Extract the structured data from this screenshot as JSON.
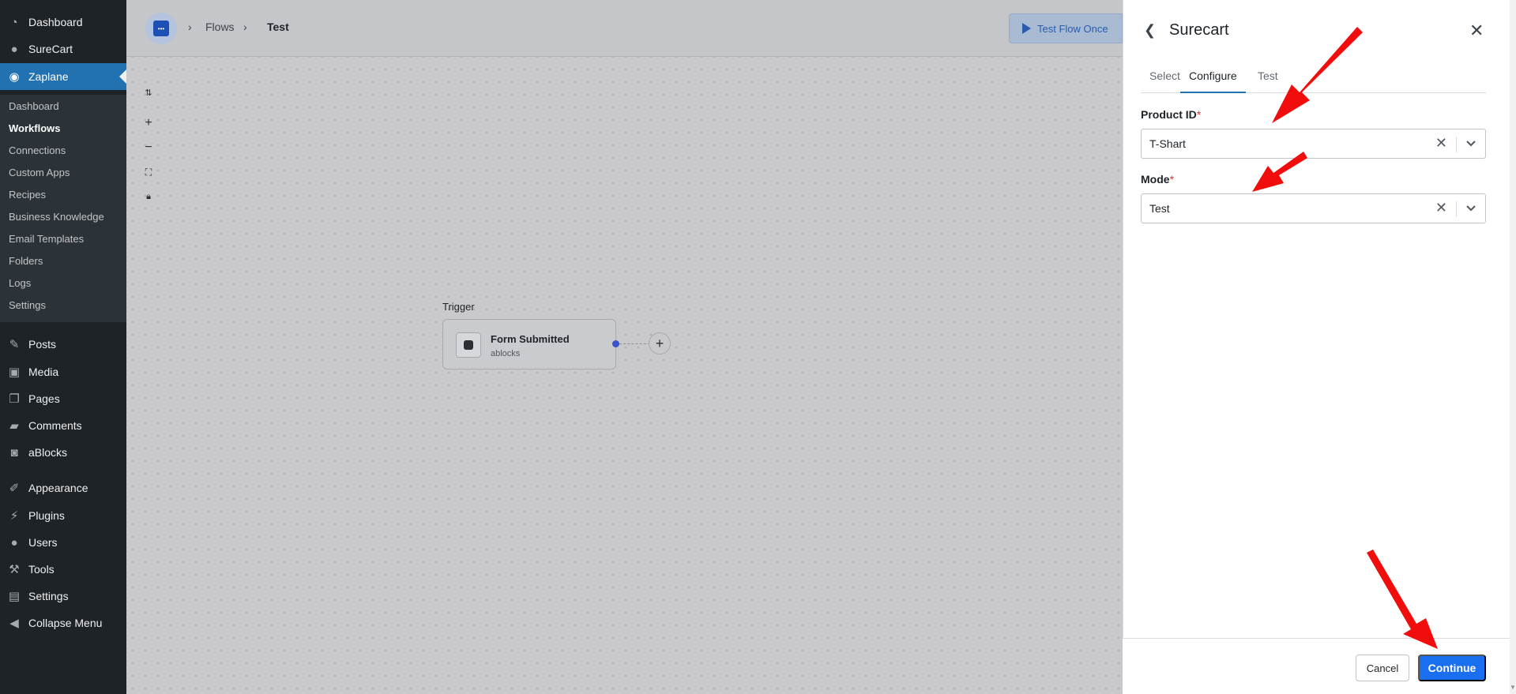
{
  "sidebar": {
    "top_items": [
      {
        "label": "Dashboard",
        "icon": "dashboard-icon"
      },
      {
        "label": "SureCart",
        "icon": "surecart-icon"
      },
      {
        "label": "Zaplane",
        "icon": "zaplane-icon",
        "active": true
      }
    ],
    "submenu": [
      "Dashboard",
      "Workflows",
      "Connections",
      "Custom Apps",
      "Recipes",
      "Business Knowledge",
      "Email Templates",
      "Folders",
      "Logs",
      "Settings"
    ],
    "submenu_current": "Workflows",
    "items": [
      {
        "label": "Posts",
        "icon": "pin-icon"
      },
      {
        "label": "Media",
        "icon": "media-icon"
      },
      {
        "label": "Pages",
        "icon": "pages-icon"
      },
      {
        "label": "Comments",
        "icon": "comment-icon"
      },
      {
        "label": "aBlocks",
        "icon": "ablocks-icon"
      },
      {
        "label": "Appearance",
        "icon": "brush-icon"
      },
      {
        "label": "Plugins",
        "icon": "plug-icon"
      },
      {
        "label": "Users",
        "icon": "user-icon"
      },
      {
        "label": "Tools",
        "icon": "wrench-icon"
      },
      {
        "label": "Settings",
        "icon": "settings-icon"
      },
      {
        "label": "Collapse Menu",
        "icon": "collapse-icon"
      }
    ]
  },
  "header": {
    "breadcrumb": [
      "Flows",
      "Test"
    ],
    "test_flow_label": "Test Flow Once"
  },
  "canvas": {
    "trigger_label": "Trigger",
    "node_title": "Form Submitted",
    "node_subtitle": "ablocks"
  },
  "panel": {
    "title": "Surecart",
    "tabs": [
      "Select",
      "Configure",
      "Test"
    ],
    "active_tab": "Configure",
    "fields": [
      {
        "label": "Product ID",
        "required_mark": "*",
        "value": "T-Shart"
      },
      {
        "label": "Mode",
        "required_mark": "*",
        "value": "Test"
      }
    ],
    "cancel_label": "Cancel",
    "continue_label": "Continue"
  },
  "colors": {
    "accent": "#2271b1",
    "primary_button": "#1a6ff0",
    "annotation_arrow": "#f20d0d",
    "sidebar_bg": "#1d2327"
  }
}
